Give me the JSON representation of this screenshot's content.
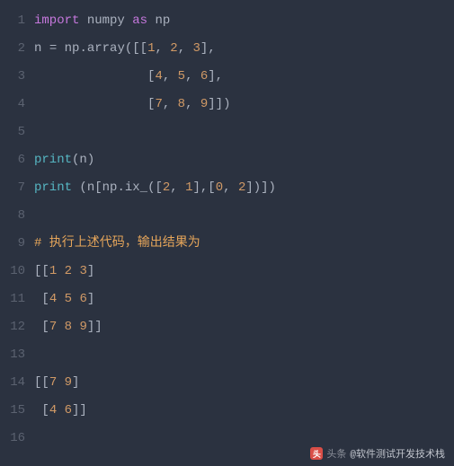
{
  "gutter": [
    "1",
    "2",
    "3",
    "4",
    "5",
    "6",
    "7",
    "8",
    "9",
    "10",
    "11",
    "12",
    "13",
    "14",
    "15",
    "16"
  ],
  "code": {
    "l1": {
      "import": "import",
      "mod": "numpy",
      "as": "as",
      "alias": "np"
    },
    "l2": {
      "lhs": "n",
      "eq": "=",
      "obj": "np",
      "dot": ".",
      "fn": "array",
      "open": "([[",
      "n1": "1",
      "c1": ", ",
      "n2": "2",
      "c2": ", ",
      "n3": "3",
      "close": "],"
    },
    "l3": {
      "indent": "               ",
      "open": "[",
      "n1": "4",
      "c1": ", ",
      "n2": "5",
      "c2": ", ",
      "n3": "6",
      "close": "],"
    },
    "l4": {
      "indent": "               ",
      "open": "[",
      "n1": "7",
      "c1": ", ",
      "n2": "8",
      "c2": ", ",
      "n3": "9",
      "close": "]])"
    },
    "l5": "",
    "l6": {
      "print": "print",
      "open": "(",
      "arg": "n",
      "close": ")"
    },
    "l7": {
      "print": "print",
      "sp": " ",
      "open": "(",
      "arg1": "n[np",
      "dot": ".",
      "fn": "ix_",
      "p1": "([",
      "n1": "2",
      "c1": ", ",
      "n2": "1",
      "p2": "],[",
      "n3": "0",
      "c2": ", ",
      "n4": "2",
      "p3": "])])"
    },
    "l8": "",
    "l9": {
      "comment": "# 执行上述代码，输出结果为"
    },
    "l10": {
      "open": "[[",
      "n1": "1",
      "s1": " ",
      "n2": "2",
      "s2": " ",
      "n3": "3",
      "close": "]"
    },
    "l11": {
      "indent": " ",
      "open": "[",
      "n1": "4",
      "s1": " ",
      "n2": "5",
      "s2": " ",
      "n3": "6",
      "close": "]"
    },
    "l12": {
      "indent": " ",
      "open": "[",
      "n1": "7",
      "s1": " ",
      "n2": "8",
      "s2": " ",
      "n3": "9",
      "close": "]]"
    },
    "l13": "",
    "l14": {
      "open": "[[",
      "n1": "7",
      "s1": " ",
      "n2": "9",
      "close": "]"
    },
    "l15": {
      "indent": " ",
      "open": "[",
      "n1": "4",
      "s1": " ",
      "n2": "6",
      "close": "]]"
    },
    "l16": ""
  },
  "footer": {
    "logo": "头",
    "label": "头条",
    "handle": "@软件测试开发技术栈"
  }
}
